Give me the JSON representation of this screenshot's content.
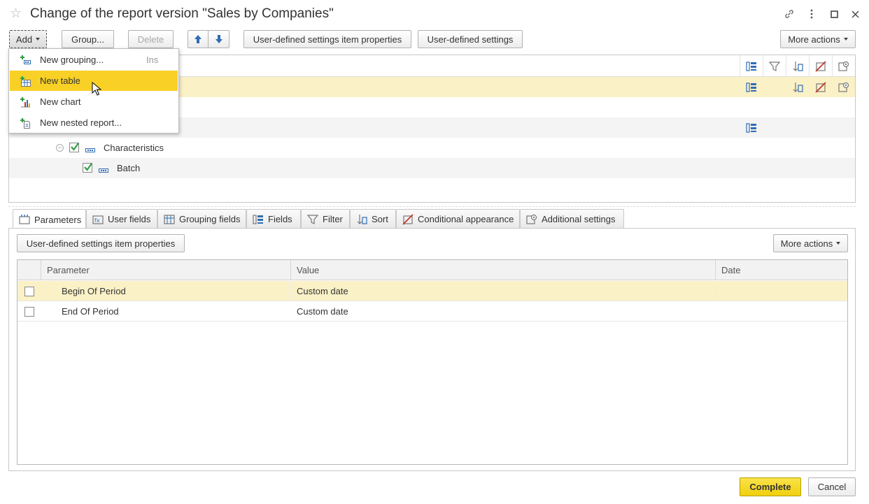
{
  "window": {
    "title": "Change of the report version \"Sales by Companies\""
  },
  "toolbar": {
    "add_label": "Add",
    "group_label": "Group...",
    "delete_label": "Delete",
    "item_properties_label": "User-defined settings item properties",
    "user_settings_label": "User-defined settings",
    "more_actions_label": "More actions"
  },
  "add_menu": {
    "items": [
      {
        "label": "New grouping...",
        "shortcut": "Ins",
        "icon": "grouping-icon"
      },
      {
        "label": "New table",
        "shortcut": "",
        "icon": "table-icon"
      },
      {
        "label": "New chart",
        "shortcut": "",
        "icon": "chart-icon"
      },
      {
        "label": "New nested report...",
        "shortcut": "",
        "icon": "nested-report-icon"
      }
    ]
  },
  "tree": {
    "nodes": [
      {
        "label": "Characteristics",
        "checked": true
      },
      {
        "label": "Batch",
        "checked": true
      }
    ]
  },
  "tabs": [
    {
      "label": "Parameters",
      "active": true
    },
    {
      "label": "User fields"
    },
    {
      "label": "Grouping fields"
    },
    {
      "label": "Fields"
    },
    {
      "label": "Filter"
    },
    {
      "label": "Sort"
    },
    {
      "label": "Conditional appearance"
    },
    {
      "label": "Additional settings"
    }
  ],
  "parameters": {
    "item_properties_label": "User-defined settings item properties",
    "more_actions_label": "More actions",
    "columns": {
      "parameter": "Parameter",
      "value": "Value",
      "date": "Date"
    },
    "rows": [
      {
        "parameter": "Begin Of Period",
        "value": "Custom date",
        "date": "",
        "checked": false
      },
      {
        "parameter": "End Of Period",
        "value": "Custom date",
        "date": "",
        "checked": false
      }
    ]
  },
  "footer": {
    "complete_label": "Complete",
    "cancel_label": "Cancel"
  },
  "colors": {
    "accent_yellow": "#f9d026",
    "selected_row": "#fbf1c7",
    "check_green": "#2f9e44",
    "icon_blue": "#2f6db5"
  }
}
